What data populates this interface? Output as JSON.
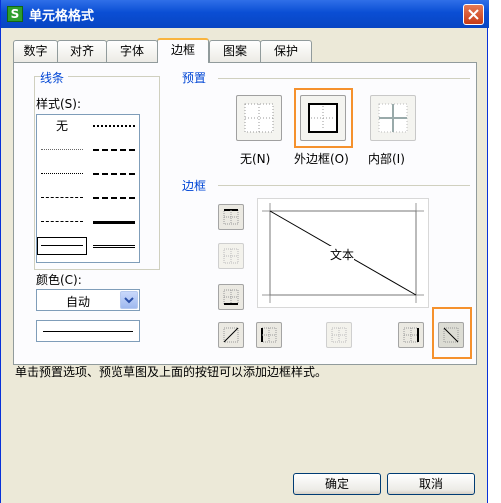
{
  "window": {
    "title": "单元格格式",
    "app_icon_letter": "S"
  },
  "tabs": [
    {
      "label": "数字",
      "active": false
    },
    {
      "label": "对齐",
      "active": false
    },
    {
      "label": "字体",
      "active": false
    },
    {
      "label": "边框",
      "active": true
    },
    {
      "label": "图案",
      "active": false
    },
    {
      "label": "保护",
      "active": false
    }
  ],
  "line": {
    "group_label": "线条",
    "style_label": "样式(S):",
    "none_label": "无",
    "color_label": "颜色(C):",
    "color_value": "自动"
  },
  "presets": {
    "group_label": "预置",
    "none_label": "无(N)",
    "outline_label": "外边框(O)",
    "inside_label": "内部(I)"
  },
  "border": {
    "group_label": "边框",
    "preview_text": "文本"
  },
  "hint": "单击预置选项、预览草图及上面的按钮可以添加边框样式。",
  "buttons": {
    "ok": "确定",
    "cancel": "取消"
  },
  "colors": {
    "title_bar": "#0a4ed4",
    "group_label": "#0046d5",
    "highlight": "#f5912d",
    "active_tab_accent": "#f9b43e"
  }
}
